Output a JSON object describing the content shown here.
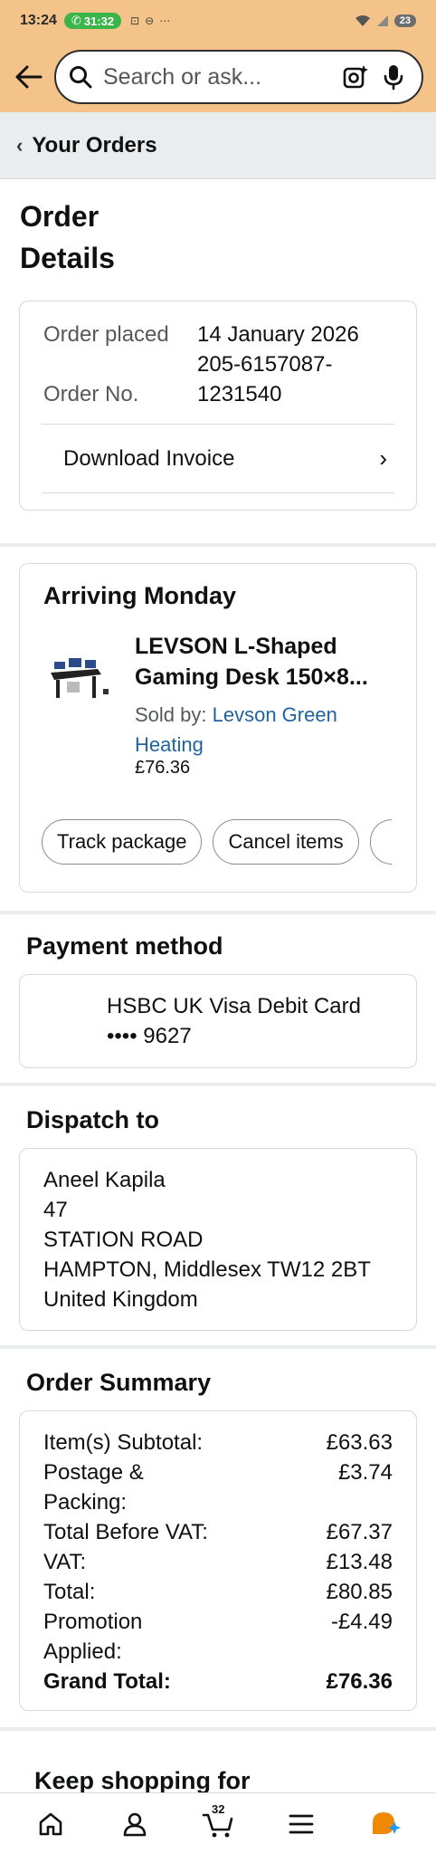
{
  "status_bar": {
    "time": "13:24",
    "call_duration": "31:32",
    "battery": "23"
  },
  "search": {
    "placeholder": "Search or ask..."
  },
  "breadcrumb": {
    "label": "Your Orders"
  },
  "page": {
    "title": "Order Details"
  },
  "order_info": {
    "placed_label": "Order placed",
    "placed_value": "14 January 2026",
    "number_label": "Order No.",
    "number_value": "205-6157087-1231540",
    "download_invoice": "Download Invoice"
  },
  "arrival": {
    "title": "Arriving Monday",
    "product_name": "LEVSON L-Shaped Gaming Desk 150×8...",
    "sold_by_label": "Sold by:",
    "seller": "Levson Green Heating",
    "price": "£76.36",
    "actions": [
      "Track package",
      "Cancel items"
    ]
  },
  "payment": {
    "title": "Payment method",
    "card_name": "HSBC UK Visa Debit Card",
    "card_digits": "•••• 9627"
  },
  "dispatch": {
    "title": "Dispatch to",
    "lines": [
      "Aneel Kapila",
      "47",
      "STATION ROAD",
      "HAMPTON, Middlesex TW12 2BT",
      "United Kingdom"
    ]
  },
  "summary": {
    "title": "Order Summary",
    "rows": [
      {
        "label": "Item(s) Subtotal:",
        "value": "£63.63"
      },
      {
        "label": "Postage & Packing:",
        "value": "£3.74"
      },
      {
        "label": "Total Before VAT:",
        "value": "£67.37"
      },
      {
        "label": "VAT:",
        "value": "£13.48"
      },
      {
        "label": "Total:",
        "value": "£80.85"
      },
      {
        "label": "Promotion Applied:",
        "value": "-£4.49"
      }
    ],
    "grand_label": "Grand Total:",
    "grand_value": "£76.36"
  },
  "keep_shopping": {
    "title": "Keep shopping for"
  },
  "bottom_nav": {
    "cart_count": "32"
  },
  "colors": {
    "header_bg": "#f3c389",
    "link": "#2162a1",
    "call_green": "#39b54a"
  }
}
